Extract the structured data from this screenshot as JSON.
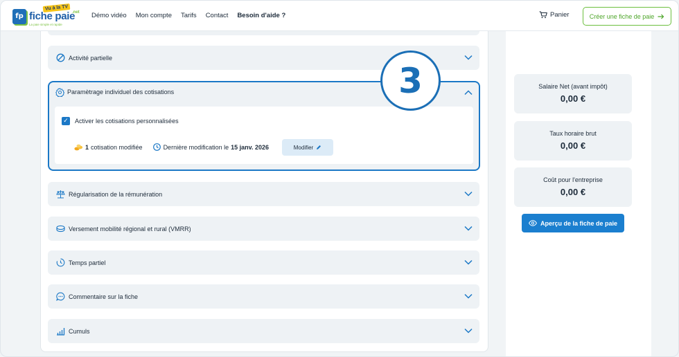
{
  "header": {
    "logo_text": "fiche paie",
    "logo_badge": "Vu à la TV",
    "logo_suffix": ".net",
    "logo_tagline": "La paie simple et rapide",
    "nav": [
      "Démo vidéo",
      "Mon compte",
      "Tarifs",
      "Contact",
      "Besoin d'aide ?"
    ],
    "cart_label": "Panier",
    "create_button": "Créer une fiche de paie"
  },
  "sections": {
    "activite_partielle": "Activité partielle",
    "parametrage": "Paramètrage individuel des cotisations",
    "regularisation": "Régularisation de la rémunération",
    "vmrr": "Versement mobilité régional et rural (VMRR)",
    "temps_partiel": "Temps partiel",
    "commentaire": "Commentaire sur la fiche",
    "cumuls": "Cumuls"
  },
  "parametrage_body": {
    "checkbox_label": "Activer les cotisations personnalisées",
    "checkbox_checked": true,
    "count": "1",
    "count_suffix": "cotisation modifiée",
    "last_mod_prefix": "Dernière modification le",
    "last_mod_date": "15 janv. 2026",
    "modify_button": "Modifier"
  },
  "step_marker": "3",
  "summary": {
    "net_label": "Salaire Net (avant impôt)",
    "net_value": "0,00 €",
    "rate_label": "Taux horaire brut",
    "rate_value": "0,00 €",
    "cost_label": "Coût pour l'entreprise",
    "cost_value": "0,00 €",
    "preview_button": "Aperçu de la fiche de paie"
  },
  "colors": {
    "accent_blue": "#1b78c6",
    "brand_green": "#6cbf3e",
    "panel_bg": "#eef2f5"
  }
}
